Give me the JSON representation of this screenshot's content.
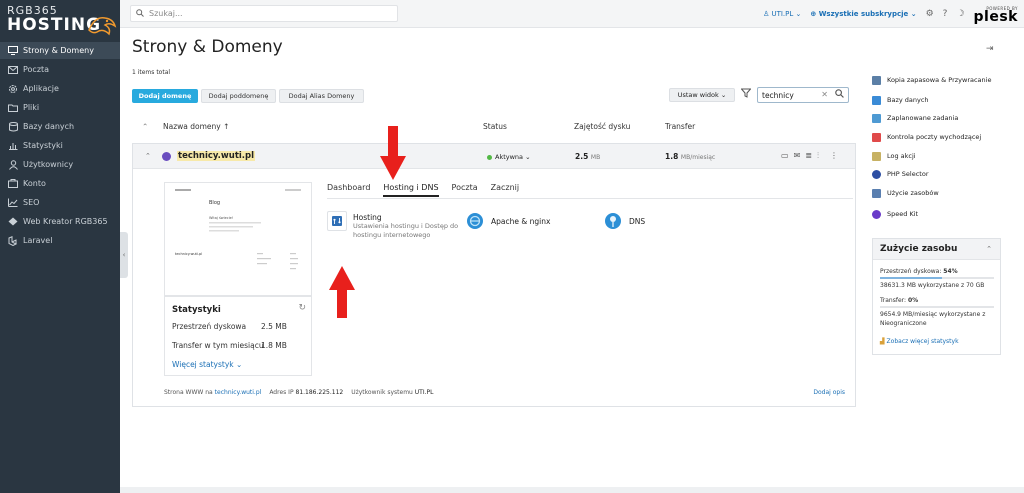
{
  "brand": {
    "line1": "RGB365",
    "line2": "HOSTING"
  },
  "sidebar": {
    "items": [
      {
        "label": "Strony & Domeny",
        "icon": "monitor-icon",
        "active": true
      },
      {
        "label": "Poczta",
        "icon": "mail-icon"
      },
      {
        "label": "Aplikacje",
        "icon": "gear-icon"
      },
      {
        "label": "Pliki",
        "icon": "folder-icon"
      },
      {
        "label": "Bazy danych",
        "icon": "database-icon"
      },
      {
        "label": "Statystyki",
        "icon": "bar-chart-icon"
      },
      {
        "label": "Użytkownicy",
        "icon": "user-icon"
      },
      {
        "label": "Konto",
        "icon": "account-icon"
      },
      {
        "label": "SEO",
        "icon": "trend-icon"
      },
      {
        "label": "Web Kreator RGB365",
        "icon": "builder-icon"
      },
      {
        "label": "Laravel",
        "icon": "laravel-icon"
      }
    ]
  },
  "header": {
    "search_placeholder": "Szukaj...",
    "user": "UTI.PL",
    "subscriptions": "Wszystkie subskrypcje",
    "plesk_powered": "POWERED BY",
    "plesk_name": "plesk"
  },
  "main": {
    "title": "Strony & Domeny",
    "items_total": "1 items total",
    "buttons": {
      "add_domain": "Dodaj domenę",
      "add_subdomain": "Dodaj poddomenę",
      "add_alias": "Dodaj Alias Domeny",
      "view": "Ustaw widok"
    },
    "filter_value": "technicy",
    "columns": {
      "name": "Nazwa domeny",
      "status": "Status",
      "disk": "Zajętość dysku",
      "transfer": "Transfer"
    },
    "domain": {
      "name": "technicy.wuti.pl",
      "status": "Aktywna",
      "disk_value": "2.5",
      "disk_unit": "MB",
      "transfer_value": "1.8",
      "transfer_unit": "MB/miesiąc"
    },
    "thumbnail": {
      "site_title": "Blog",
      "post_title": "Witaj świecie!",
      "footer_title": "technicy.wuti.pl"
    },
    "stats": {
      "title": "Statystyki",
      "disk_label": "Przestrzeń dyskowa",
      "disk_value": "2.5 MB",
      "transfer_label": "Transfer w tym miesiącu",
      "transfer_value": "1.8 MB",
      "more": "Więcej statystyk"
    },
    "tabs": [
      "Dashboard",
      "Hosting i DNS",
      "Poczta",
      "Zacznij"
    ],
    "tools": {
      "hosting_title": "Hosting",
      "hosting_desc": "Ustawienia hostingu i Dostęp do hostingu internetowego",
      "apache_title": "Apache & nginx",
      "dns_title": "DNS"
    },
    "footer": {
      "www_label": "Strona WWW na",
      "www_value": "technicy.wuti.pl",
      "ip_label": "Adres IP",
      "ip_value": "81.186.225.112",
      "user_label": "Użytkownik systemu",
      "user_value": "UTI.PL",
      "add_desc": "Dodaj opis"
    }
  },
  "right_panel": {
    "items": [
      {
        "label": "Kopia zapasowa & Przywracanie",
        "color": "#5b7fa6"
      },
      {
        "label": "Bazy danych",
        "color": "#3a8bd6"
      },
      {
        "label": "Zaplanowane zadania",
        "color": "#4e9ad3"
      },
      {
        "label": "Kontrola poczty wychodzącej",
        "color": "#e04a4a"
      },
      {
        "label": "Log akcji",
        "color": "#c7b163"
      },
      {
        "label": "PHP Selector",
        "color": "#2e4fa3"
      },
      {
        "label": "Użycie zasobów",
        "color": "#5a7fb0"
      },
      {
        "label": "Speed Kit",
        "color": "#6a3cc9"
      }
    ],
    "usage": {
      "title": "Zużycie zasobu",
      "disk_label": "Przestrzeń dyskowa:",
      "disk_pct": "54%",
      "disk_detail": "38631.3 MB wykorzystane z 70 GB",
      "disk_fill_pct": 54,
      "transfer_label": "Transfer:",
      "transfer_pct": "0%",
      "transfer_detail": "9654.9 MB/miesiąc wykorzystane z Nieograniczone",
      "more": "Zobacz więcej statystyk"
    }
  },
  "colors": {
    "accent": "#28aade",
    "sidebar_bg": "#2a3641",
    "arrow": "#e8201c",
    "status_ok": "#52b845"
  }
}
